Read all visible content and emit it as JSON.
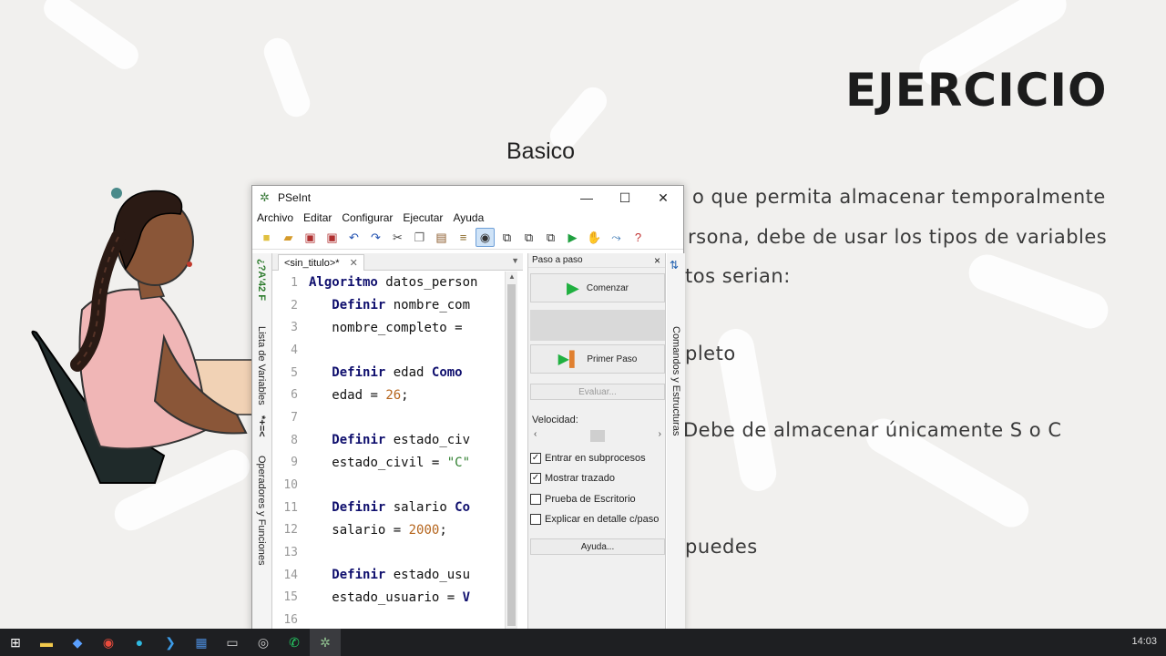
{
  "slide": {
    "title": "EJERCICIO",
    "subtitle": "Basico",
    "text_lines": [
      "o que permita almacenar temporalmente",
      "rsona, debe de usar los tipos de variables",
      "tos serian:",
      "pleto",
      "Debe de almacenar únicamente S o C",
      "puedes"
    ]
  },
  "window": {
    "app_title": "PSeInt",
    "menu": [
      "Archivo",
      "Editar",
      "Configurar",
      "Ejecutar",
      "Ayuda"
    ],
    "tab_label": "<sin_titulo>*",
    "left_strip_labels": [
      "Lista de Variables",
      "Operadores y Funciones"
    ],
    "left_strip_symbols": [
      "*+=<",
      "¿?A'42 F"
    ],
    "right_strip_label": "Comandos y Estructuras",
    "code_lines": [
      {
        "n": "1",
        "kw": "Algoritmo",
        "rest": " datos_person"
      },
      {
        "n": "2",
        "kw": "Definir",
        "rest": " nombre_com"
      },
      {
        "n": "3",
        "kw": "",
        "rest": "nombre_completo ="
      },
      {
        "n": "4",
        "kw": "",
        "rest": ""
      },
      {
        "n": "5",
        "kw": "Definir",
        "rest": " edad ",
        "kw2": "Como"
      },
      {
        "n": "6",
        "kw": "",
        "rest": "edad = ",
        "num": "26",
        "tail": ";"
      },
      {
        "n": "7",
        "kw": "",
        "rest": ""
      },
      {
        "n": "8",
        "kw": "Definir",
        "rest": " estado_civ"
      },
      {
        "n": "9",
        "kw": "",
        "rest": "estado_civil = ",
        "str": "\"C\""
      },
      {
        "n": "10",
        "kw": "",
        "rest": ""
      },
      {
        "n": "11",
        "kw": "Definir",
        "rest": " salario ",
        "kw2": "Co"
      },
      {
        "n": "12",
        "kw": "",
        "rest": "salario = ",
        "num": "2000",
        "tail": ";"
      },
      {
        "n": "13",
        "kw": "",
        "rest": ""
      },
      {
        "n": "14",
        "kw": "Definir",
        "rest": " estado_usu"
      },
      {
        "n": "15",
        "kw": "",
        "rest": "estado_usuario = ",
        "kw2": "V"
      },
      {
        "n": "16",
        "kw": "",
        "rest": ""
      }
    ],
    "step_panel": {
      "header": "Paso a paso",
      "close": "×",
      "start_label": "Comenzar",
      "first_step_label": "Primer Paso",
      "evaluate_label": "Evaluar...",
      "speed_label": "Velocidad:",
      "options": [
        {
          "label": "Entrar en subprocesos",
          "checked": true
        },
        {
          "label": "Mostrar trazado",
          "checked": true
        },
        {
          "label": "Prueba de Escritorio",
          "checked": false
        },
        {
          "label": "Explicar en detalle c/paso",
          "checked": false
        }
      ],
      "help_label": "Ayuda..."
    }
  },
  "taskbar": {
    "clock": "14:03"
  }
}
